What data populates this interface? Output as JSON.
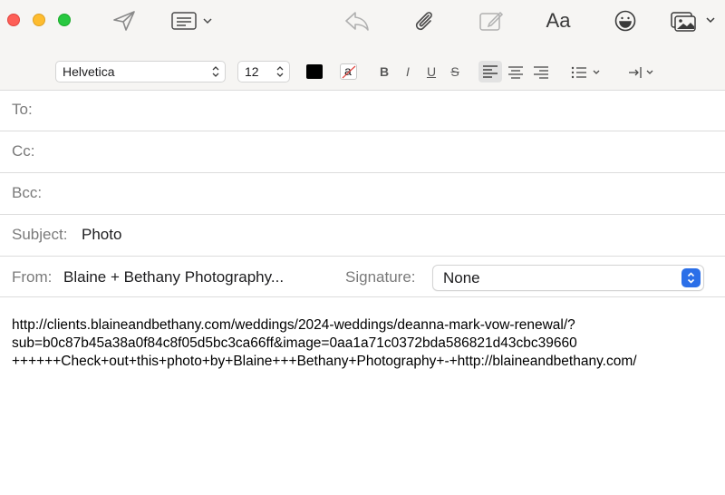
{
  "toolbar": {
    "icons": [
      "send-icon",
      "header-fields-icon",
      "reply-icon",
      "attach-icon",
      "markup-icon",
      "format-icon",
      "emoji-icon",
      "photo-browser-icon"
    ],
    "format_label": "Aa"
  },
  "format_bar": {
    "font": "Helvetica",
    "size": "12",
    "bold": "B",
    "italic": "I",
    "underline": "U",
    "strike": "S",
    "highlight_letter": "a",
    "text_color": "#000000"
  },
  "fields": {
    "to_label": "To:",
    "cc_label": "Cc:",
    "bcc_label": "Bcc:",
    "subject_label": "Subject:",
    "subject_value": "Photo",
    "from_label": "From:",
    "from_value": "Blaine + Bethany Photography...",
    "signature_label": "Signature:",
    "signature_value": "None"
  },
  "message": {
    "lines": [
      "http://clients.blaineandbethany.com/weddings/2024-weddings/deanna-mark-vow-renewal/?",
      "sub=b0c87b45a38a0f84c8f05d5bc3ca66ff&image=0aa1a71c0372bda586821d43cbc39660",
      "++++++Check+out+this+photo+by+Blaine+++Bethany+Photography+-+http://blaineandbethany.com/"
    ]
  },
  "colors": {
    "close": "#fe5f57",
    "minimize": "#febc2e",
    "zoom": "#28c840",
    "accent": "#2b6fe8"
  }
}
